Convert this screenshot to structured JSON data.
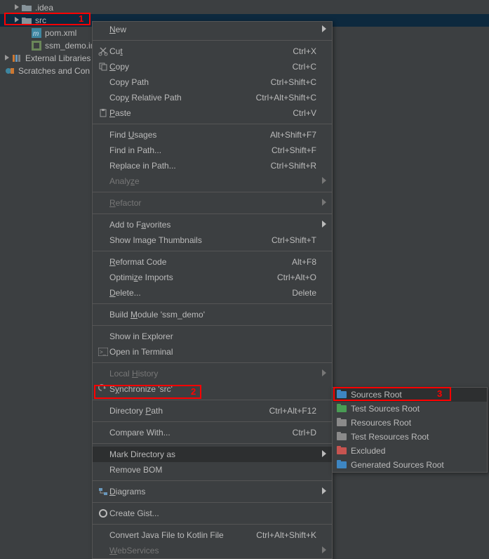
{
  "tree": {
    "items": [
      {
        "label": ".idea"
      },
      {
        "label": "src"
      },
      {
        "label": "pom.xml"
      },
      {
        "label": "ssm_demo.iml"
      },
      {
        "label": "External Libraries"
      },
      {
        "label": "Scratches and Con"
      }
    ]
  },
  "menu": {
    "new": "New",
    "cut": "Cut",
    "cut_k": "Ctrl+X",
    "copy": "Copy",
    "copy_k": "Ctrl+C",
    "copy_path": "Copy Path",
    "copy_path_k": "Ctrl+Shift+C",
    "copy_rel": "Copy Relative Path",
    "copy_rel_k": "Ctrl+Alt+Shift+C",
    "paste": "Paste",
    "paste_k": "Ctrl+V",
    "find_usages": "Find Usages",
    "find_usages_k": "Alt+Shift+F7",
    "find_in_path": "Find in Path...",
    "find_in_path_k": "Ctrl+Shift+F",
    "replace_in_path": "Replace in Path...",
    "replace_in_path_k": "Ctrl+Shift+R",
    "analyze": "Analyze",
    "refactor": "Refactor",
    "favorites": "Add to Favorites",
    "thumbnails": "Show Image Thumbnails",
    "thumbnails_k": "Ctrl+Shift+T",
    "reformat": "Reformat Code",
    "reformat_k": "Alt+F8",
    "optimize": "Optimize Imports",
    "optimize_k": "Ctrl+Alt+O",
    "delete": "Delete...",
    "delete_k": "Delete",
    "build": "Build Module 'ssm_demo'",
    "show_explorer": "Show in Explorer",
    "open_terminal": "Open in Terminal",
    "local_history": "Local History",
    "synchronize": "Synchronize 'src'",
    "directory_path": "Directory Path",
    "directory_path_k": "Ctrl+Alt+F12",
    "compare_with": "Compare With...",
    "compare_with_k": "Ctrl+D",
    "mark_dir": "Mark Directory as",
    "remove_bom": "Remove BOM",
    "diagrams": "Diagrams",
    "create_gist": "Create Gist...",
    "convert_kotlin": "Convert Java File to Kotlin File",
    "convert_kotlin_k": "Ctrl+Alt+Shift+K",
    "webservices": "WebServices"
  },
  "submenu": {
    "sources_root": "Sources Root",
    "test_sources_root": "Test Sources Root",
    "resources_root": "Resources Root",
    "test_resources_root": "Test Resources Root",
    "excluded": "Excluded",
    "generated_sources_root": "Generated Sources Root"
  },
  "annotations": {
    "n1": "1",
    "n2": "2",
    "n3": "3"
  }
}
